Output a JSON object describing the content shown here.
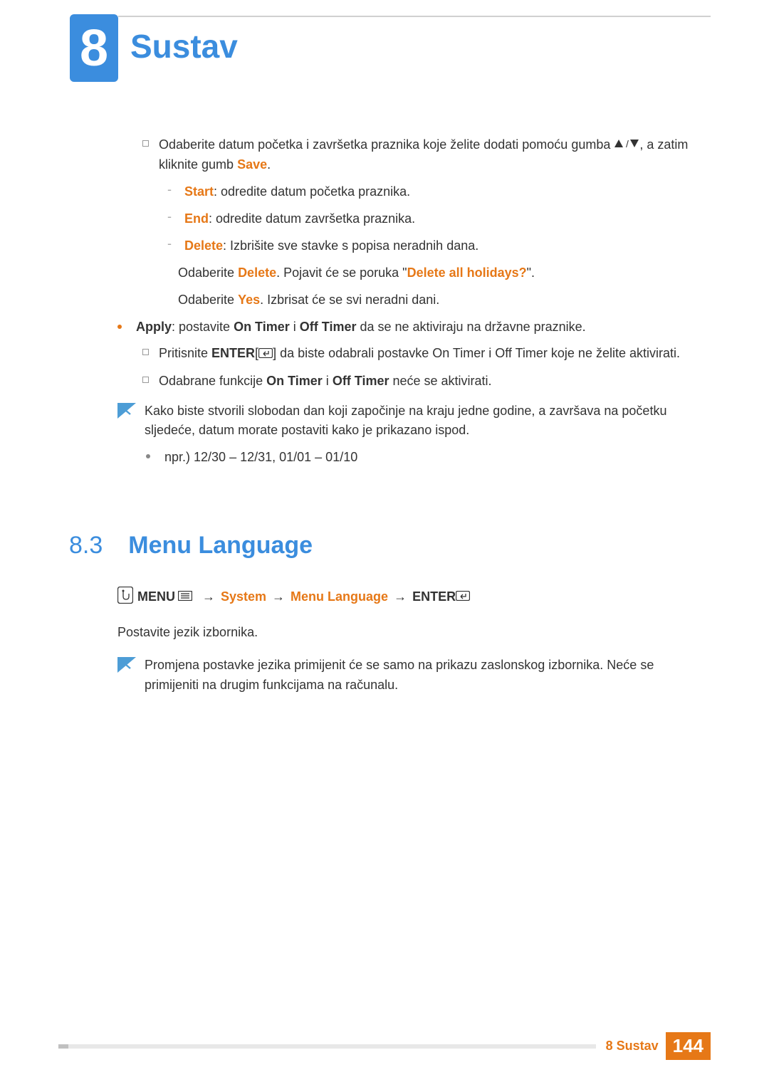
{
  "chapter": {
    "number": "8",
    "title": "Sustav"
  },
  "body": {
    "item1": {
      "pre": "Odaberite datum početka i završetka praznika koje želite dodati pomoću gumba ",
      "post": ", a zatim kliknite gumb ",
      "save": "Save",
      "period": "."
    },
    "start": {
      "label": "Start",
      "text": ": odredite datum početka praznika."
    },
    "end": {
      "label": "End",
      "text": ": odredite datum završetka praznika."
    },
    "delete": {
      "label": "Delete",
      "text": ": Izbrišite sve stavke s popisa neradnih dana."
    },
    "deleteLine2": {
      "pre": "Odaberite ",
      "bold1": "Delete",
      "mid": ". Pojavit će se poruka \"",
      "bold2": "Delete all holidays?",
      "post": "\"."
    },
    "deleteLine3": {
      "pre": "Odaberite ",
      "bold": "Yes",
      "post": ". Izbrisat će se svi neradni dani."
    },
    "apply": {
      "label": "Apply",
      "pre": ": postavite ",
      "bold1": "On Timer",
      "mid": " i ",
      "bold2": "Off Timer",
      "post": " da se ne aktiviraju na državne praznike."
    },
    "enterLine": {
      "pre": "Pritisnite ",
      "bold": "ENTER",
      "post": " da biste odabrali postavke On Timer i Off Timer koje ne želite aktivirati."
    },
    "selectedLine": {
      "pre": "Odabrane funkcije ",
      "bold1": "On Timer",
      "mid": " i ",
      "bold2": "Off Timer",
      "post": " neće se aktivirati."
    },
    "note1": "Kako biste stvorili slobodan dan koji započinje na kraju jedne godine, a završava na početku sljedeće, datum morate postaviti kako je prikazano ispod.",
    "example": "npr.) 12/30 – 12/31, 01/01 – 01/10"
  },
  "section": {
    "number": "8.3",
    "title": "Menu Language"
  },
  "breadcrumb": {
    "menu": "MENU",
    "system": "System",
    "menulang": "Menu Language",
    "enter": "ENTER",
    "arrow": "→"
  },
  "langText": "Postavite jezik izbornika.",
  "note2": "Promjena postavke jezika primijenit će se samo na prikazu zaslonskog izbornika. Neće se primijeniti na drugim funkcijama na računalu.",
  "footer": {
    "label": "8 Sustav",
    "page": "144"
  }
}
